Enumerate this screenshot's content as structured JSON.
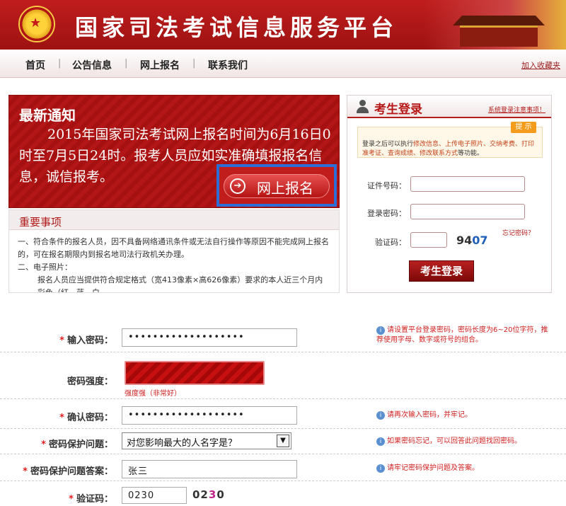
{
  "header": {
    "site_title": "国家司法考试信息服务平台",
    "gate_sign": "国家司法考试"
  },
  "nav": {
    "items": [
      {
        "label": "首页"
      },
      {
        "label": "公告信息"
      },
      {
        "label": "网上报名"
      },
      {
        "label": "联系我们"
      }
    ],
    "separator": "|",
    "favorite": "加入收藏夹"
  },
  "notice": {
    "title": "最新通知",
    "body": "2015年国家司法考试网上报名时间为6月16日0时至7月5日24时。报考人员应如实准确填报报名信息，诚信报考。",
    "register_button": "网上报名",
    "register_icon": "arrow-right-circle-icon"
  },
  "important": {
    "title": "重要事项",
    "lines": [
      "一、符合条件的报名人员，因不具备网络通讯条件或无法自行操作等原因不能完成网上报名的，可在报名期限内到报名地司法行政机关办理。",
      "二、电子照片：",
      "报名人员应当提供符合规定格式（宽413像素×高626像素）要求的本人近三个月内彩色（红、蓝、白"
    ]
  },
  "login": {
    "title": "考生登录",
    "note_link": "系统登录注意事项！",
    "tip_tag": "提 示",
    "tip_prefix": "登录之后可以执行",
    "tip_actions": "修改信息、上传电子照片、交纳考费、打印准考证、查询成绩、修改联系方式",
    "tip_suffix": "等功能。",
    "id_label": "证件号码：",
    "password_label": "登录密码：",
    "captcha_label": "验证码：",
    "captcha_a": "94",
    "captcha_b": "07",
    "forgot": "忘记密码？",
    "submit": "考生登录"
  },
  "form": {
    "password": {
      "label": "输入密码：",
      "value": "•••••••••••••••••••",
      "hint": "请设置平台登录密码，密码长度为6~20位字符，推荐使用字母、数字或符号的组合。"
    },
    "strength": {
      "label": "密码强度：",
      "value": "强度强（非常好）",
      "level": 1.0
    },
    "confirm": {
      "label": "确认密码：",
      "value": "•••••••••••••••••••",
      "hint": "请再次输入密码，并牢记。"
    },
    "question": {
      "label": "密码保护问题：",
      "value": "对您影响最大的人名字是？",
      "hint": "如果密码忘记，可以回答此问题找回密码。"
    },
    "answer": {
      "label": "密码保护问题答案：",
      "value": "张三",
      "hint": "请牢记密码保护问题及答案。"
    },
    "captcha": {
      "label": "验证码：",
      "value": "0230",
      "image_a": "02",
      "image_b": "3",
      "image_c": "0"
    },
    "required_mark": "*",
    "info_icon": "info-circle-icon"
  },
  "colors": {
    "brand_red": "#b31616",
    "highlight_blue": "#2b6fd6",
    "hint_red": "#d22020"
  }
}
